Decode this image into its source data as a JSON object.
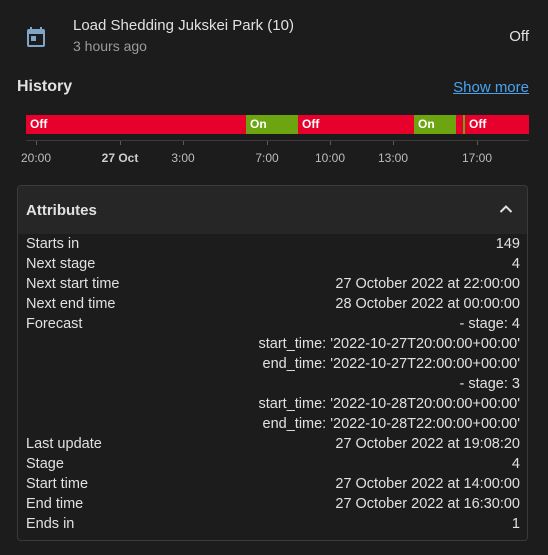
{
  "entity": {
    "title": "Load Shedding Jukskei Park (10)",
    "subtitle": "3 hours ago",
    "state": "Off",
    "icon": "calendar-icon"
  },
  "history": {
    "title": "History",
    "show_more": "Show more",
    "segments": [
      {
        "label": "Off",
        "state": "off"
      },
      {
        "label": "On",
        "state": "on"
      },
      {
        "label": "Off",
        "state": "off"
      },
      {
        "label": "On",
        "state": "on"
      },
      {
        "label": "",
        "state": "off"
      },
      {
        "label": "Off",
        "state": "off"
      }
    ],
    "ticks": [
      "20:00",
      "27 Oct",
      "3:00",
      "7:00",
      "10:00",
      "13:00",
      "17:00"
    ],
    "colors": {
      "off": "#e8002c",
      "on": "#6da510"
    }
  },
  "attributes": {
    "title": "Attributes",
    "rows": [
      {
        "key": "Starts in",
        "value": "149"
      },
      {
        "key": "Next stage",
        "value": "4"
      },
      {
        "key": "Next start time",
        "value": "27 October 2022 at 22:00:00"
      },
      {
        "key": "Next end time",
        "value": "28 October 2022 at 00:00:00"
      },
      {
        "key": "Forecast",
        "value": "- stage: 4"
      },
      {
        "key": "",
        "value": "start_time: '2022-10-27T20:00:00+00:00'"
      },
      {
        "key": "",
        "value": "end_time: '2022-10-27T22:00:00+00:00'"
      },
      {
        "key": "",
        "value": "- stage: 3"
      },
      {
        "key": "",
        "value": "start_time: '2022-10-28T20:00:00+00:00'"
      },
      {
        "key": "",
        "value": "end_time: '2022-10-28T22:00:00+00:00'"
      },
      {
        "key": "Last update",
        "value": "27 October 2022 at 19:08:20"
      },
      {
        "key": "Stage",
        "value": "4"
      },
      {
        "key": "Start time",
        "value": "27 October 2022 at 14:00:00"
      },
      {
        "key": "End time",
        "value": "27 October 2022 at 16:30:00"
      },
      {
        "key": "Ends in",
        "value": "1"
      }
    ]
  }
}
